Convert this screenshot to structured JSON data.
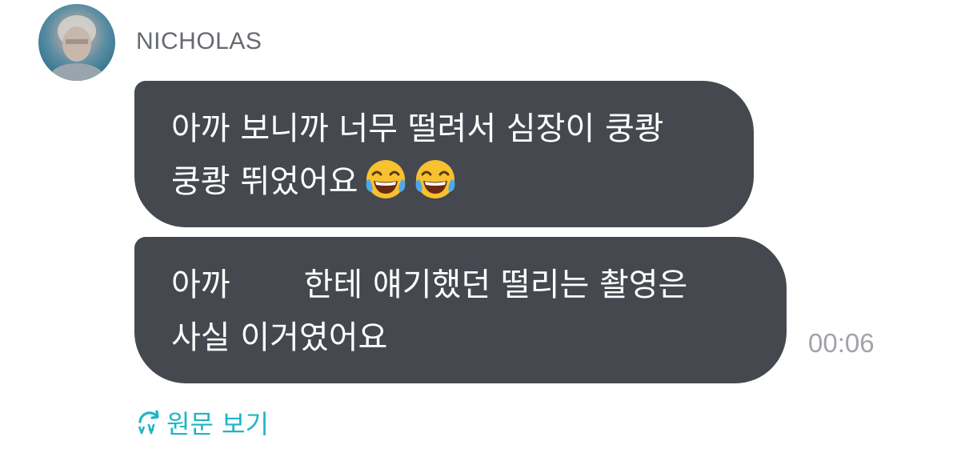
{
  "sender": {
    "name": "NICHOLAS"
  },
  "messages": [
    {
      "lines": [
        "아까 보니까 너무 떨려서 심장이 쿵쾅",
        "쿵쾅 뛰었어요"
      ],
      "emojis": [
        "face-with-tears-of-joy",
        "face-with-tears-of-joy"
      ]
    },
    {
      "line1_before": "아까",
      "line1_after": "한테 얘기했던 떨리는 촬영은",
      "line2": "사실 이거였어요"
    }
  ],
  "timestamp": "00:06",
  "translation": {
    "view_original_label": "원문 보기",
    "accent_color": "#1fb5c4"
  },
  "colors": {
    "bubble": "#45484f",
    "timestamp": "#a0a3a8"
  }
}
